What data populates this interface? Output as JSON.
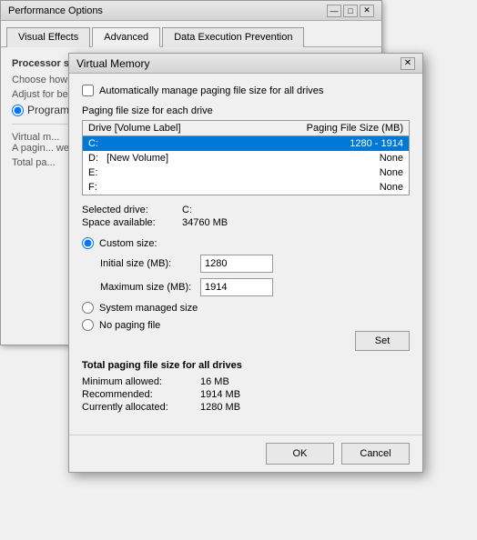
{
  "perf_window": {
    "title": "Performance Options",
    "controls": {
      "minimize": "—",
      "maximize": "□",
      "close": "✕"
    },
    "tabs": [
      {
        "id": "visual-effects",
        "label": "Visual Effects",
        "active": false
      },
      {
        "id": "advanced",
        "label": "Advanced",
        "active": true
      },
      {
        "id": "dep",
        "label": "Data Execution Prevention",
        "active": false
      }
    ],
    "body": {
      "processor_label": "Processor scheduling",
      "choose_label": "Choose how to allocate processor resources.",
      "adjust_label": "Adjust for best performance of:",
      "radio_programs": "Programs",
      "virtual_memory_label": "Virtual m...",
      "vm_desc": "A pagin... were RA...",
      "total_paging_label": "Total pa..."
    }
  },
  "vm_dialog": {
    "title": "Virtual Memory",
    "close_btn": "✕",
    "auto_manage_label": "Automatically manage paging file size for all drives",
    "auto_manage_checked": false,
    "paging_section_label": "Paging file size for each drive",
    "table": {
      "headers": {
        "drive": "Drive  [Volume Label]",
        "paging": "Paging File Size (MB)"
      },
      "rows": [
        {
          "drive": "C:",
          "label": "",
          "paging": "1280 - 1914",
          "selected": true
        },
        {
          "drive": "D:",
          "label": "  [New Volume]",
          "paging": "None",
          "selected": false
        },
        {
          "drive": "E:",
          "label": "",
          "paging": "None",
          "selected": false
        },
        {
          "drive": "F:",
          "label": "",
          "paging": "None",
          "selected": false
        }
      ]
    },
    "selected_drive_label": "Selected drive:",
    "selected_drive_value": "C:",
    "space_available_label": "Space available:",
    "space_available_value": "34760 MB",
    "custom_size_label": "Custom size:",
    "initial_size_label": "Initial size (MB):",
    "initial_size_value": "1280",
    "maximum_size_label": "Maximum size (MB):",
    "maximum_size_value": "1914",
    "system_managed_label": "System managed size",
    "no_paging_label": "No paging file",
    "set_btn_label": "Set",
    "total_section_label": "Total paging file size for all drives",
    "minimum_allowed_label": "Minimum allowed:",
    "minimum_allowed_value": "16 MB",
    "recommended_label": "Recommended:",
    "recommended_value": "1914 MB",
    "currently_allocated_label": "Currently allocated:",
    "currently_allocated_value": "1280 MB",
    "ok_label": "OK",
    "cancel_label": "Cancel"
  }
}
